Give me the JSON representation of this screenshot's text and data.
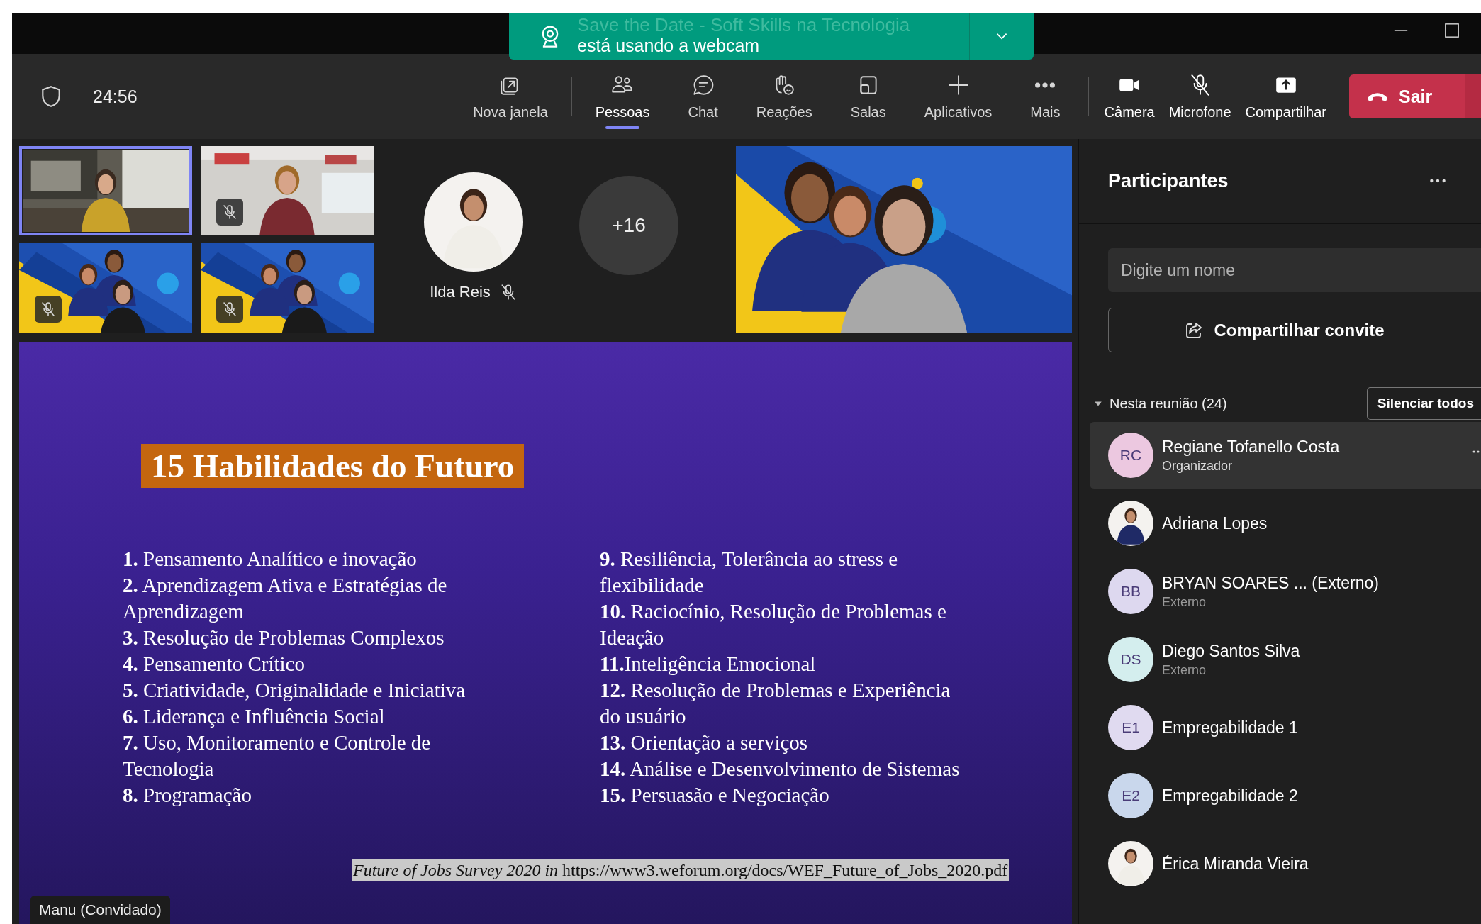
{
  "title_bar": {
    "meeting_title": "Save the Date - Soft Skills na Tecnologia"
  },
  "notification": {
    "message": "está usando a webcam"
  },
  "toolbar": {
    "timer": "24:56",
    "actions": [
      {
        "label": "Nova janela",
        "selected": false
      },
      {
        "label": "Pessoas",
        "selected": true
      },
      {
        "label": "Chat",
        "selected": false
      },
      {
        "label": "Reações",
        "selected": false
      },
      {
        "label": "Salas",
        "selected": false
      },
      {
        "label": "Aplicativos",
        "selected": false
      },
      {
        "label": "Mais",
        "selected": false
      }
    ],
    "camera": {
      "label": "Câmera",
      "on": true
    },
    "microphone": {
      "label": "Microfone",
      "muted": true
    },
    "share": {
      "label": "Compartilhar"
    },
    "leave": {
      "label": "Sair"
    }
  },
  "video_strip": {
    "tiles": [
      {
        "kind": "picture",
        "speaking": true,
        "muted": false
      },
      {
        "kind": "picture",
        "speaking": false,
        "muted": true
      },
      {
        "kind": "picture",
        "speaking": false,
        "muted": true
      },
      {
        "kind": "picture",
        "speaking": false,
        "muted": true
      }
    ],
    "avatar_participant": {
      "name": "Ilda Reis",
      "muted": true
    },
    "overflow_count": "+16",
    "featured_video": {
      "kind": "picture"
    }
  },
  "slide": {
    "title": "15 Habilidades do Futuro",
    "left_items": [
      "**1.** Pensamento Analítico e inovação",
      "**2.** Aprendizagem Ativa e Estratégias  de Aprendizagem",
      "**3.** Resolução de Problemas Complexos",
      "**4.** Pensamento Crítico",
      "**5.** Criatividade, Originalidade e Iniciativa",
      "**6.** Liderança e Influência Social",
      "**7.** Uso, Monitoramento e Controle de Tecnologia",
      "**8.** Programação"
    ],
    "right_items": [
      "**9.** Resiliência, Tolerância ao stress e flexibilidade",
      "**10.** Raciocínio, Resolução de Problemas e Ideação",
      "**11.**Inteligência Emocional",
      "**12.** Resolução de Problemas e Experiência do usuário",
      "**13.** Orientação a serviços",
      "**14.** Análise e Desenvolvimento de Sistemas",
      "**15.** Persuasão e Negociação"
    ],
    "source": "*Future of Jobs Survey 2020 in* https://www3.weforum.org/docs/WEF_Future_of_Jobs_2020.pdf"
  },
  "speaker_label": "Manu (Convidado)",
  "participants_panel": {
    "title": "Participantes",
    "search": {
      "placeholder": "Digite um nome"
    },
    "invite_button": "Compartilhar convite",
    "section": {
      "label": "Nesta reunião (24)",
      "expanded": true,
      "mute_all": "Silenciar todos"
    },
    "participants": [
      {
        "kind": "initials",
        "initials": "RC",
        "color": "#ecc8e0",
        "name": "Regiane Tofanello Costa",
        "role": "Organizador",
        "selected": true
      },
      {
        "name": "Adriana Lopes",
        "selected": false
      },
      {
        "kind": "initials",
        "initials": "BB",
        "color": "#ddd8ef",
        "name": "BRYAN SOARES ...  (Externo)",
        "role": "Externo",
        "selected": false
      },
      {
        "kind": "initials",
        "initials": "DS",
        "color": "#d4eeee",
        "name": "Diego Santos Silva",
        "role": "Externo",
        "selected": false
      },
      {
        "kind": "initials",
        "initials": "E1",
        "color": "#e0daf0",
        "name": "Empregabilidade 1",
        "selected": false
      },
      {
        "kind": "initials",
        "initials": "E2",
        "color": "#c9d7ec",
        "name": "Empregabilidade 2",
        "selected": false
      },
      {
        "name": "Érica Miranda Vieira",
        "selected": false
      }
    ]
  }
}
